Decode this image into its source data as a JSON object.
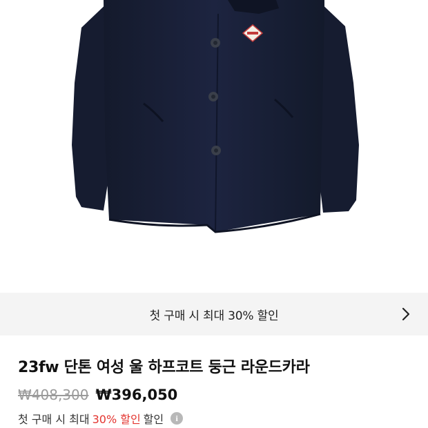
{
  "promo": {
    "prefix": "첫 구매 시",
    "highlight": "최대 30%",
    "suffix": "할인",
    "chevron_icon": "chevron-right-icon"
  },
  "product": {
    "title": "23fw 단톤 여성 울 하프코트 둥근 라운드카라",
    "original_price": "₩408,300",
    "sale_price": "₩396,050",
    "benefit": {
      "prefix": "첫 구매 시 최대",
      "discount": "30% 할인",
      "suffix": "할인",
      "info_icon": "info-icon",
      "info_glyph": "i"
    }
  },
  "colors": {
    "coat": "#1b2238",
    "accent_red": "#e3342f",
    "promo_bg": "#f4f4f4",
    "muted": "#9a9a9a"
  }
}
